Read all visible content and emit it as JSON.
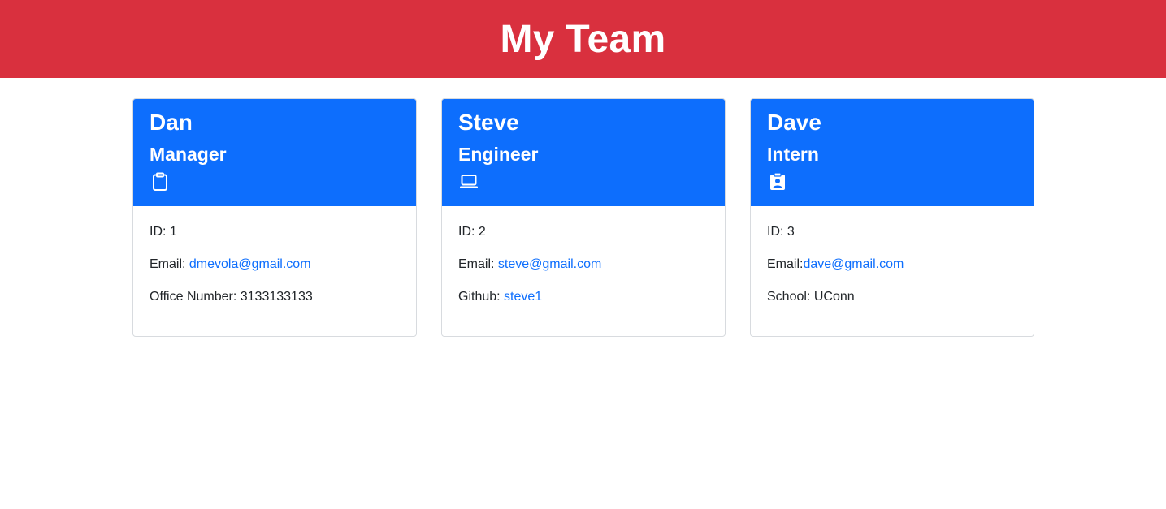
{
  "page": {
    "title": "My Team"
  },
  "colors": {
    "header": "#d9303e",
    "card_header": "#0d6efd",
    "link": "#0d6efd"
  },
  "cards": [
    {
      "name": "Dan",
      "role": "Manager",
      "icon": "clipboard-icon",
      "id_label": "ID:",
      "id": "1",
      "email_label": "Email:",
      "email": "dmevola@gmail.com",
      "extra_label": "Office Number:",
      "extra_value": "3133133133"
    },
    {
      "name": "Steve",
      "role": "Engineer",
      "icon": "laptop-icon",
      "id_label": "ID:",
      "id": "2",
      "email_label": "Email:",
      "email": "steve@gmail.com",
      "extra_label": "Github:",
      "extra_value": "steve1"
    },
    {
      "name": "Dave",
      "role": "Intern",
      "icon": "student-id-icon",
      "id_label": "ID:",
      "id": "3",
      "email_label": "Email:",
      "email": "dave@gmail.com",
      "extra_label": "School:",
      "extra_value": "UConn"
    }
  ]
}
